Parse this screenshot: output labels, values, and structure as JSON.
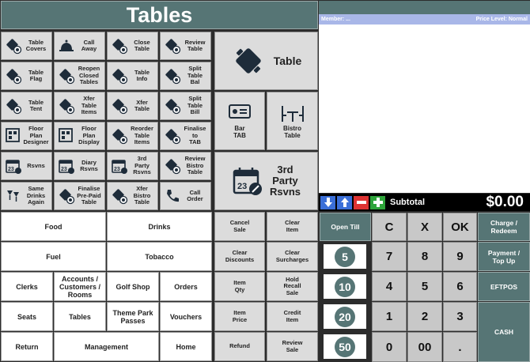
{
  "header": {
    "title": "Tables"
  },
  "table_buttons": [
    {
      "label": "Table\nCovers",
      "icon": "table-covers-icon"
    },
    {
      "label": "Call\nAway",
      "icon": "bell-icon"
    },
    {
      "label": "Close\nTable",
      "icon": "close-table-icon"
    },
    {
      "label": "Review\nTable",
      "icon": "review-table-icon"
    },
    {
      "label": "Table\nFlag",
      "icon": "table-flag-icon"
    },
    {
      "label": "Reopen\nClosed\nTables",
      "icon": "reopen-table-icon"
    },
    {
      "label": "Table\nInfo",
      "icon": "table-info-icon"
    },
    {
      "label": "Split\nTable\nBal",
      "icon": "split-balance-icon"
    },
    {
      "label": "Table\nTent",
      "icon": "table-tent-icon"
    },
    {
      "label": "Xfer\nTable\nItems",
      "icon": "transfer-items-icon"
    },
    {
      "label": "Xfer\nTable",
      "icon": "transfer-table-icon"
    },
    {
      "label": "Split\nTable\nBill",
      "icon": "split-bill-icon"
    },
    {
      "label": "Floor\nPlan\nDesigner",
      "icon": "floor-plan-designer-icon"
    },
    {
      "label": "Floor\nPlan\nDisplay",
      "icon": "floor-plan-display-icon"
    },
    {
      "label": "Reorder\nTable\nItems",
      "icon": "reorder-items-icon"
    },
    {
      "label": "Finalise\nto\nTAB",
      "icon": "finalise-tab-icon"
    },
    {
      "label": "Rsvns",
      "icon": "calendar-icon"
    },
    {
      "label": "Diary\nRsvns",
      "icon": "diary-icon"
    },
    {
      "label": "3rd\nParty\nRsvns",
      "icon": "calendar-icon"
    },
    {
      "label": "Review\nBistro\nTable",
      "icon": "review-bistro-icon"
    },
    {
      "label": "Same\nDrinks\nAgain",
      "icon": "drinks-icon"
    },
    {
      "label": "Finalise\nPre-Paid\nTable",
      "icon": "prepaid-icon"
    },
    {
      "label": "Xfer\nBistro\nTable",
      "icon": "transfer-bistro-icon"
    },
    {
      "label": "Call\nOrder",
      "icon": "phone-icon"
    }
  ],
  "big_buttons": {
    "table": "Table",
    "bar_tab": "Bar\nTAB",
    "bistro_table": "Bistro\nTable",
    "third_party": "3rd\nParty\nRsvns"
  },
  "categories": [
    [
      "Food",
      "Drinks"
    ],
    [
      "Fuel",
      "Tobacco"
    ],
    [
      "Clerks",
      "Accounts /\nCustomers /\nRooms",
      "Golf Shop",
      "Orders"
    ],
    [
      "Seats",
      "Tables",
      "Theme Park\nPasses",
      "Vouchers"
    ],
    [
      "Return",
      "Management",
      "Home"
    ]
  ],
  "functions": [
    [
      "Cancel\nSale",
      "Clear\nItem"
    ],
    [
      "Clear\nDiscounts",
      "Clear\nSurcharges"
    ],
    [
      "Item\nQty",
      "Hold\nRecall\nSale"
    ],
    [
      "Item\nPrice",
      "Credit\nItem"
    ],
    [
      "Refund",
      "Review\nSale"
    ]
  ],
  "receipt": {
    "member_label": "Member: ...",
    "price_level": "Price Level: Normal"
  },
  "subtotal": {
    "label": "Subtotal",
    "amount": "$0.00"
  },
  "keypad": {
    "open_till": "Open Till",
    "clear": "C",
    "cancel": "X",
    "ok": "OK",
    "keys": [
      [
        "7",
        "8",
        "9"
      ],
      [
        "4",
        "5",
        "6"
      ],
      [
        "1",
        "2",
        "3"
      ],
      [
        "0",
        "00",
        "."
      ]
    ]
  },
  "cash_notes": [
    "5",
    "10",
    "20",
    "50"
  ],
  "tenders": {
    "charge": "Charge /\nRedeem",
    "payment": "Payment /\nTop Up",
    "eftpos": "EFTPOS",
    "cash": "CASH"
  },
  "colors": {
    "teal": "#567575",
    "button_grey": "#dcdcdc",
    "member_bar": "#a9b7e8"
  }
}
